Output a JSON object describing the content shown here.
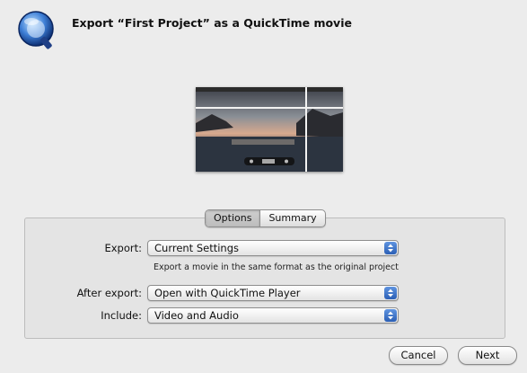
{
  "dialog": {
    "title": "Export “First Project” as a QuickTime movie",
    "icon": "quicktime-icon"
  },
  "tabs": [
    {
      "label": "Options",
      "selected": true
    },
    {
      "label": "Summary",
      "selected": false
    }
  ],
  "form": {
    "export": {
      "label": "Export:",
      "value": "Current Settings"
    },
    "hint": "Export a movie in the same format as the original project",
    "after_export": {
      "label": "After export:",
      "value": "Open with QuickTime Player"
    },
    "include": {
      "label": "Include:",
      "value": "Video and Audio"
    }
  },
  "buttons": {
    "cancel": "Cancel",
    "next": "Next"
  },
  "colors": {
    "background": "#ececec",
    "popup_arrow_accent": "#2b5fb5"
  }
}
